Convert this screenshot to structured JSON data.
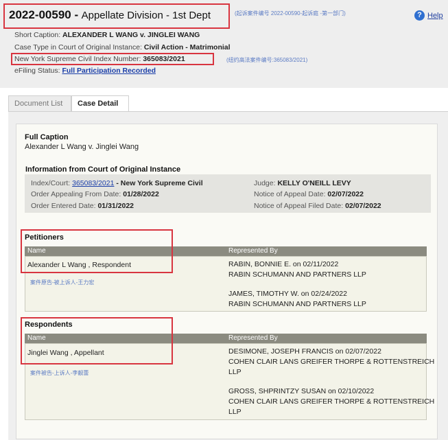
{
  "header": {
    "case_number": "2022-00590 -",
    "division": "Appellate Division - 1st Dept",
    "case_note": "(起诉案件编号 2022-00590-起诉庭 -第一部门)",
    "help_label": "Help",
    "short_caption_label": "Short Caption:",
    "short_caption_value": "ALEXANDER L WANG v. JINGLEI WANG",
    "case_type_label": "Case Type in Court of Original Instance:",
    "case_type_value": "Civil Action - Matrimonial",
    "index_label": "New York Supreme Civil Index Number:",
    "index_value": "365083/2021",
    "index_note": "(纽约高法案件编号:365083/2021)",
    "efiling_label": "eFiling Status:",
    "efiling_value": "Full Participation Recorded"
  },
  "tabs": [
    {
      "label": "Document List"
    },
    {
      "label": "Case Detail"
    }
  ],
  "full_caption": {
    "title": "Full Caption",
    "value": "Alexander L Wang v. Jinglei Wang"
  },
  "original_court": {
    "title": "Information from Court of Original Instance",
    "index_label": "Index/Court:",
    "index_link": "365083/2021",
    "index_court": "- New York Supreme Civil",
    "judge_label": "Judge:",
    "judge_value": "KELLY O'NEILL LEVY",
    "order_appealing_label": "Order Appealing From Date:",
    "order_appealing_value": "01/28/2022",
    "notice_label": "Notice of Appeal Date:",
    "notice_value": "02/07/2022",
    "order_entered_label": "Order Entered Date:",
    "order_entered_value": "01/31/2022",
    "notice_filed_label": "Notice of Appeal Filed Date:",
    "notice_filed_value": "02/07/2022"
  },
  "petitioners": {
    "title": "Petitioners",
    "col_name": "Name",
    "col_rep": "Represented By",
    "name": "Alexander L Wang , Respondent",
    "note": "案件原告-被上诉人-王力宏",
    "reps": [
      {
        "line1": "RABIN, BONNIE E. on 02/11/2022",
        "line2": "RABIN SCHUMANN AND PARTNERS LLP"
      },
      {
        "line1": "JAMES, TIMOTHY W. on 02/24/2022",
        "line2": "RABIN SCHUMANN AND PARTNERS LLP"
      }
    ]
  },
  "respondents": {
    "title": "Respondents",
    "col_name": "Name",
    "col_rep": "Represented By",
    "name": "Jinglei Wang , Appellant",
    "note": "案件被告-上诉人-李靓蕾",
    "reps": [
      {
        "line1": "DESIMONE, JOSEPH FRANCIS on 02/07/2022",
        "line2": "COHEN CLAIR LANS GREIFER THORPE & ROTTENSTREICH",
        "line3": "LLP"
      },
      {
        "line1": "GROSS, SHPRINTZY SUSAN on 02/10/2022",
        "line2": "COHEN CLAIR LANS GREIFER THORPE & ROTTENSTREICH",
        "line3": "LLP"
      }
    ]
  },
  "colors": {
    "highlight": "#d8343f",
    "link": "#1a3ea8",
    "table_header": "#8b8b80"
  }
}
